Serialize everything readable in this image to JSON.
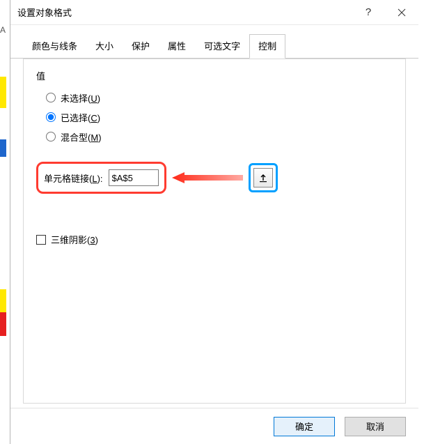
{
  "titlebar": {
    "title": "设置对象格式",
    "help_label": "?",
    "close_label": "×"
  },
  "tabs": [
    {
      "label": "颜色与线条"
    },
    {
      "label": "大小"
    },
    {
      "label": "保护"
    },
    {
      "label": "属性"
    },
    {
      "label": "可选文字"
    },
    {
      "label": "控制"
    }
  ],
  "active_tab_index": 5,
  "control_panel": {
    "value_group_label": "值",
    "radios": [
      {
        "label": "未选择(",
        "key": "U",
        "suffix": ")"
      },
      {
        "label": "已选择(",
        "key": "C",
        "suffix": ")"
      },
      {
        "label": "混合型(",
        "key": "M",
        "suffix": ")"
      }
    ],
    "selected_radio_index": 1,
    "cell_link_label_prefix": "单元格链接(",
    "cell_link_label_key": "L",
    "cell_link_label_suffix": "):",
    "cell_link_value": "$A$5",
    "shadow_label_prefix": "三维阴影(",
    "shadow_label_key": "3",
    "shadow_label_suffix": ")"
  },
  "footer": {
    "ok": "确定",
    "cancel": "取消"
  },
  "bg_letter": "A"
}
